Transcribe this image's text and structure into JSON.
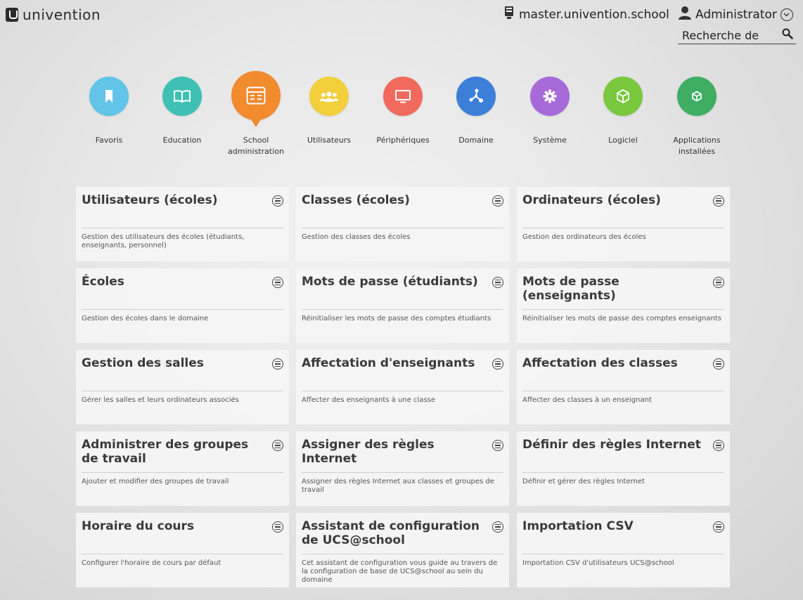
{
  "header": {
    "brand": "univention",
    "hostname": "master.univention.school",
    "username": "Administrator",
    "search_placeholder": "Recherche de"
  },
  "categories": [
    {
      "label": "Favoris",
      "color": "#62c4e8",
      "icon": "bookmark-icon"
    },
    {
      "label": "Education",
      "color": "#3ec0b4",
      "icon": "book-icon"
    },
    {
      "label": "School administration",
      "color": "#f28a2e",
      "icon": "school-admin-icon",
      "active": true
    },
    {
      "label": "Utilisateurs",
      "color": "#f2cf3b",
      "icon": "users-icon"
    },
    {
      "label": "Périphériques",
      "color": "#f26a5e",
      "icon": "monitor-icon"
    },
    {
      "label": "Domaine",
      "color": "#3c7fd9",
      "icon": "network-icon"
    },
    {
      "label": "Système",
      "color": "#a76ad9",
      "icon": "gear-icon"
    },
    {
      "label": "Logiciel",
      "color": "#7ac83e",
      "icon": "package-icon"
    },
    {
      "label": "Applications installées",
      "color": "#3fae63",
      "icon": "apps-icon"
    }
  ],
  "tiles": [
    {
      "title": "Utilisateurs (écoles)",
      "desc": "Gestion des utilisateurs des écoles (étudiants, enseignants, personnel)"
    },
    {
      "title": "Classes (écoles)",
      "desc": "Gestion des classes des écoles"
    },
    {
      "title": "Ordinateurs (écoles)",
      "desc": "Gestion des ordinateurs des écoles"
    },
    {
      "title": "Écoles",
      "desc": "Gestion des écoles dans le domaine"
    },
    {
      "title": "Mots de passe (étudiants)",
      "desc": "Réinitialiser les mots de passe des comptes étudiants"
    },
    {
      "title": "Mots de passe (enseignants)",
      "desc": "Réinitialiser les mots de passe des comptes enseignants"
    },
    {
      "title": "Gestion des salles",
      "desc": "Gérer les salles et leurs ordinateurs associés"
    },
    {
      "title": "Affectation d'enseignants",
      "desc": "Affecter des enseignants à une classe"
    },
    {
      "title": "Affectation des classes",
      "desc": "Affecter des classes à un enseignant"
    },
    {
      "title": "Administrer des groupes de travail",
      "desc": "Ajouter et modifier des groupes de travail"
    },
    {
      "title": "Assigner des règles Internet",
      "desc": "Assigner des règles Internet aux classes et groupes de travail"
    },
    {
      "title": "Définir des règles Internet",
      "desc": "Définir et gérer des règles Internet"
    },
    {
      "title": "Horaire du cours",
      "desc": "Configurer l'horaire de cours par défaut"
    },
    {
      "title": "Assistant de configuration de UCS@school",
      "desc": "Cet assistant de configuration vous guide au travers de la configuration de base de UCS@school au sein du domaine"
    },
    {
      "title": "Importation CSV",
      "desc": "Importation CSV d'utilisateurs UCS@school"
    }
  ]
}
